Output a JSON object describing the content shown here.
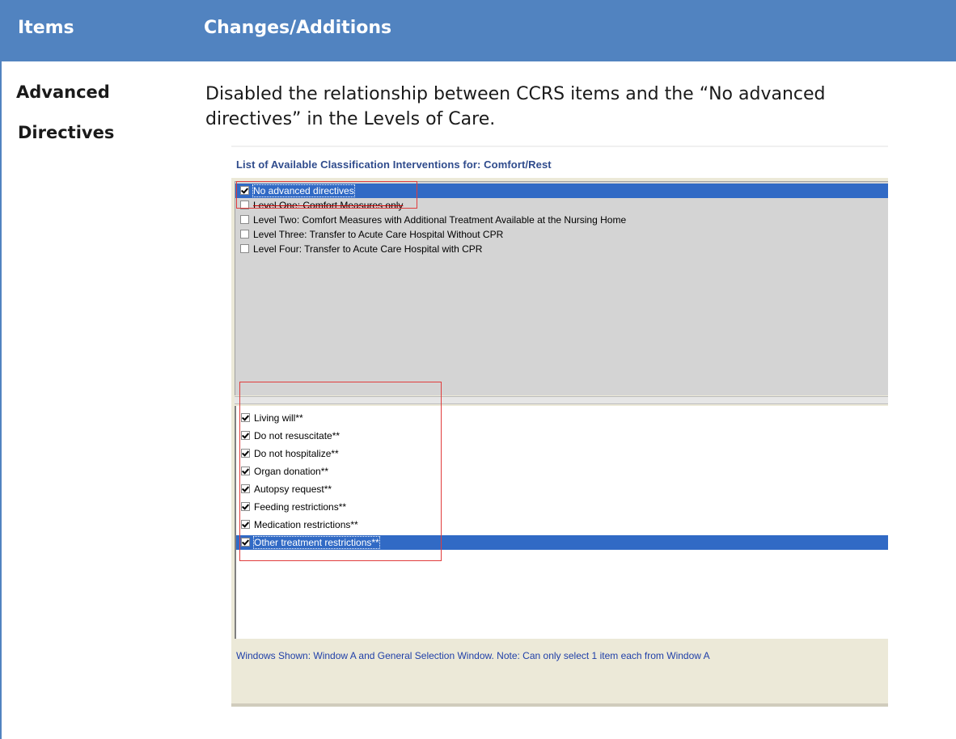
{
  "table": {
    "col1_header": "Items",
    "col2_header": "Changes/Additions",
    "row": {
      "item_line1": "Advanced",
      "item_line2": "Directives",
      "description": "Disabled the relationship between CCRS items and the “No advanced directives” in the Levels of Care."
    }
  },
  "window": {
    "title": "List of Available Classification Interventions for: Comfort/Rest",
    "window_a_items": [
      {
        "label": "No advanced directives",
        "checked": true,
        "selected": true
      },
      {
        "label": "Level One: Comfort Measures only",
        "checked": false,
        "selected": false
      },
      {
        "label": "Level Two: Comfort Measures with Additional Treatment Available at the Nursing Home",
        "checked": false,
        "selected": false
      },
      {
        "label": "Level Three: Transfer to Acute Care Hospital Without CPR",
        "checked": false,
        "selected": false
      },
      {
        "label": "Level Four: Transfer to Acute Care Hospital with CPR",
        "checked": false,
        "selected": false
      }
    ],
    "general_items": [
      {
        "label": "Living will**",
        "checked": true,
        "selected": false
      },
      {
        "label": "Do not resuscitate**",
        "checked": true,
        "selected": false
      },
      {
        "label": "Do not hospitalize**",
        "checked": true,
        "selected": false
      },
      {
        "label": "Organ donation**",
        "checked": true,
        "selected": false
      },
      {
        "label": "Autopsy request**",
        "checked": true,
        "selected": false
      },
      {
        "label": "Feeding restrictions**",
        "checked": true,
        "selected": false
      },
      {
        "label": "Medication restrictions**",
        "checked": true,
        "selected": false
      },
      {
        "label": "Other treatment restrictions**",
        "checked": true,
        "selected": true
      }
    ],
    "status_text": "Windows Shown:  Window A and General Selection Window.  Note:  Can only select 1 item each from Window A"
  },
  "colors": {
    "header_bg": "#5183c0",
    "selection": "#316ac5",
    "highlight_box": "#e03c3c",
    "status_text": "#1f3fa8"
  }
}
